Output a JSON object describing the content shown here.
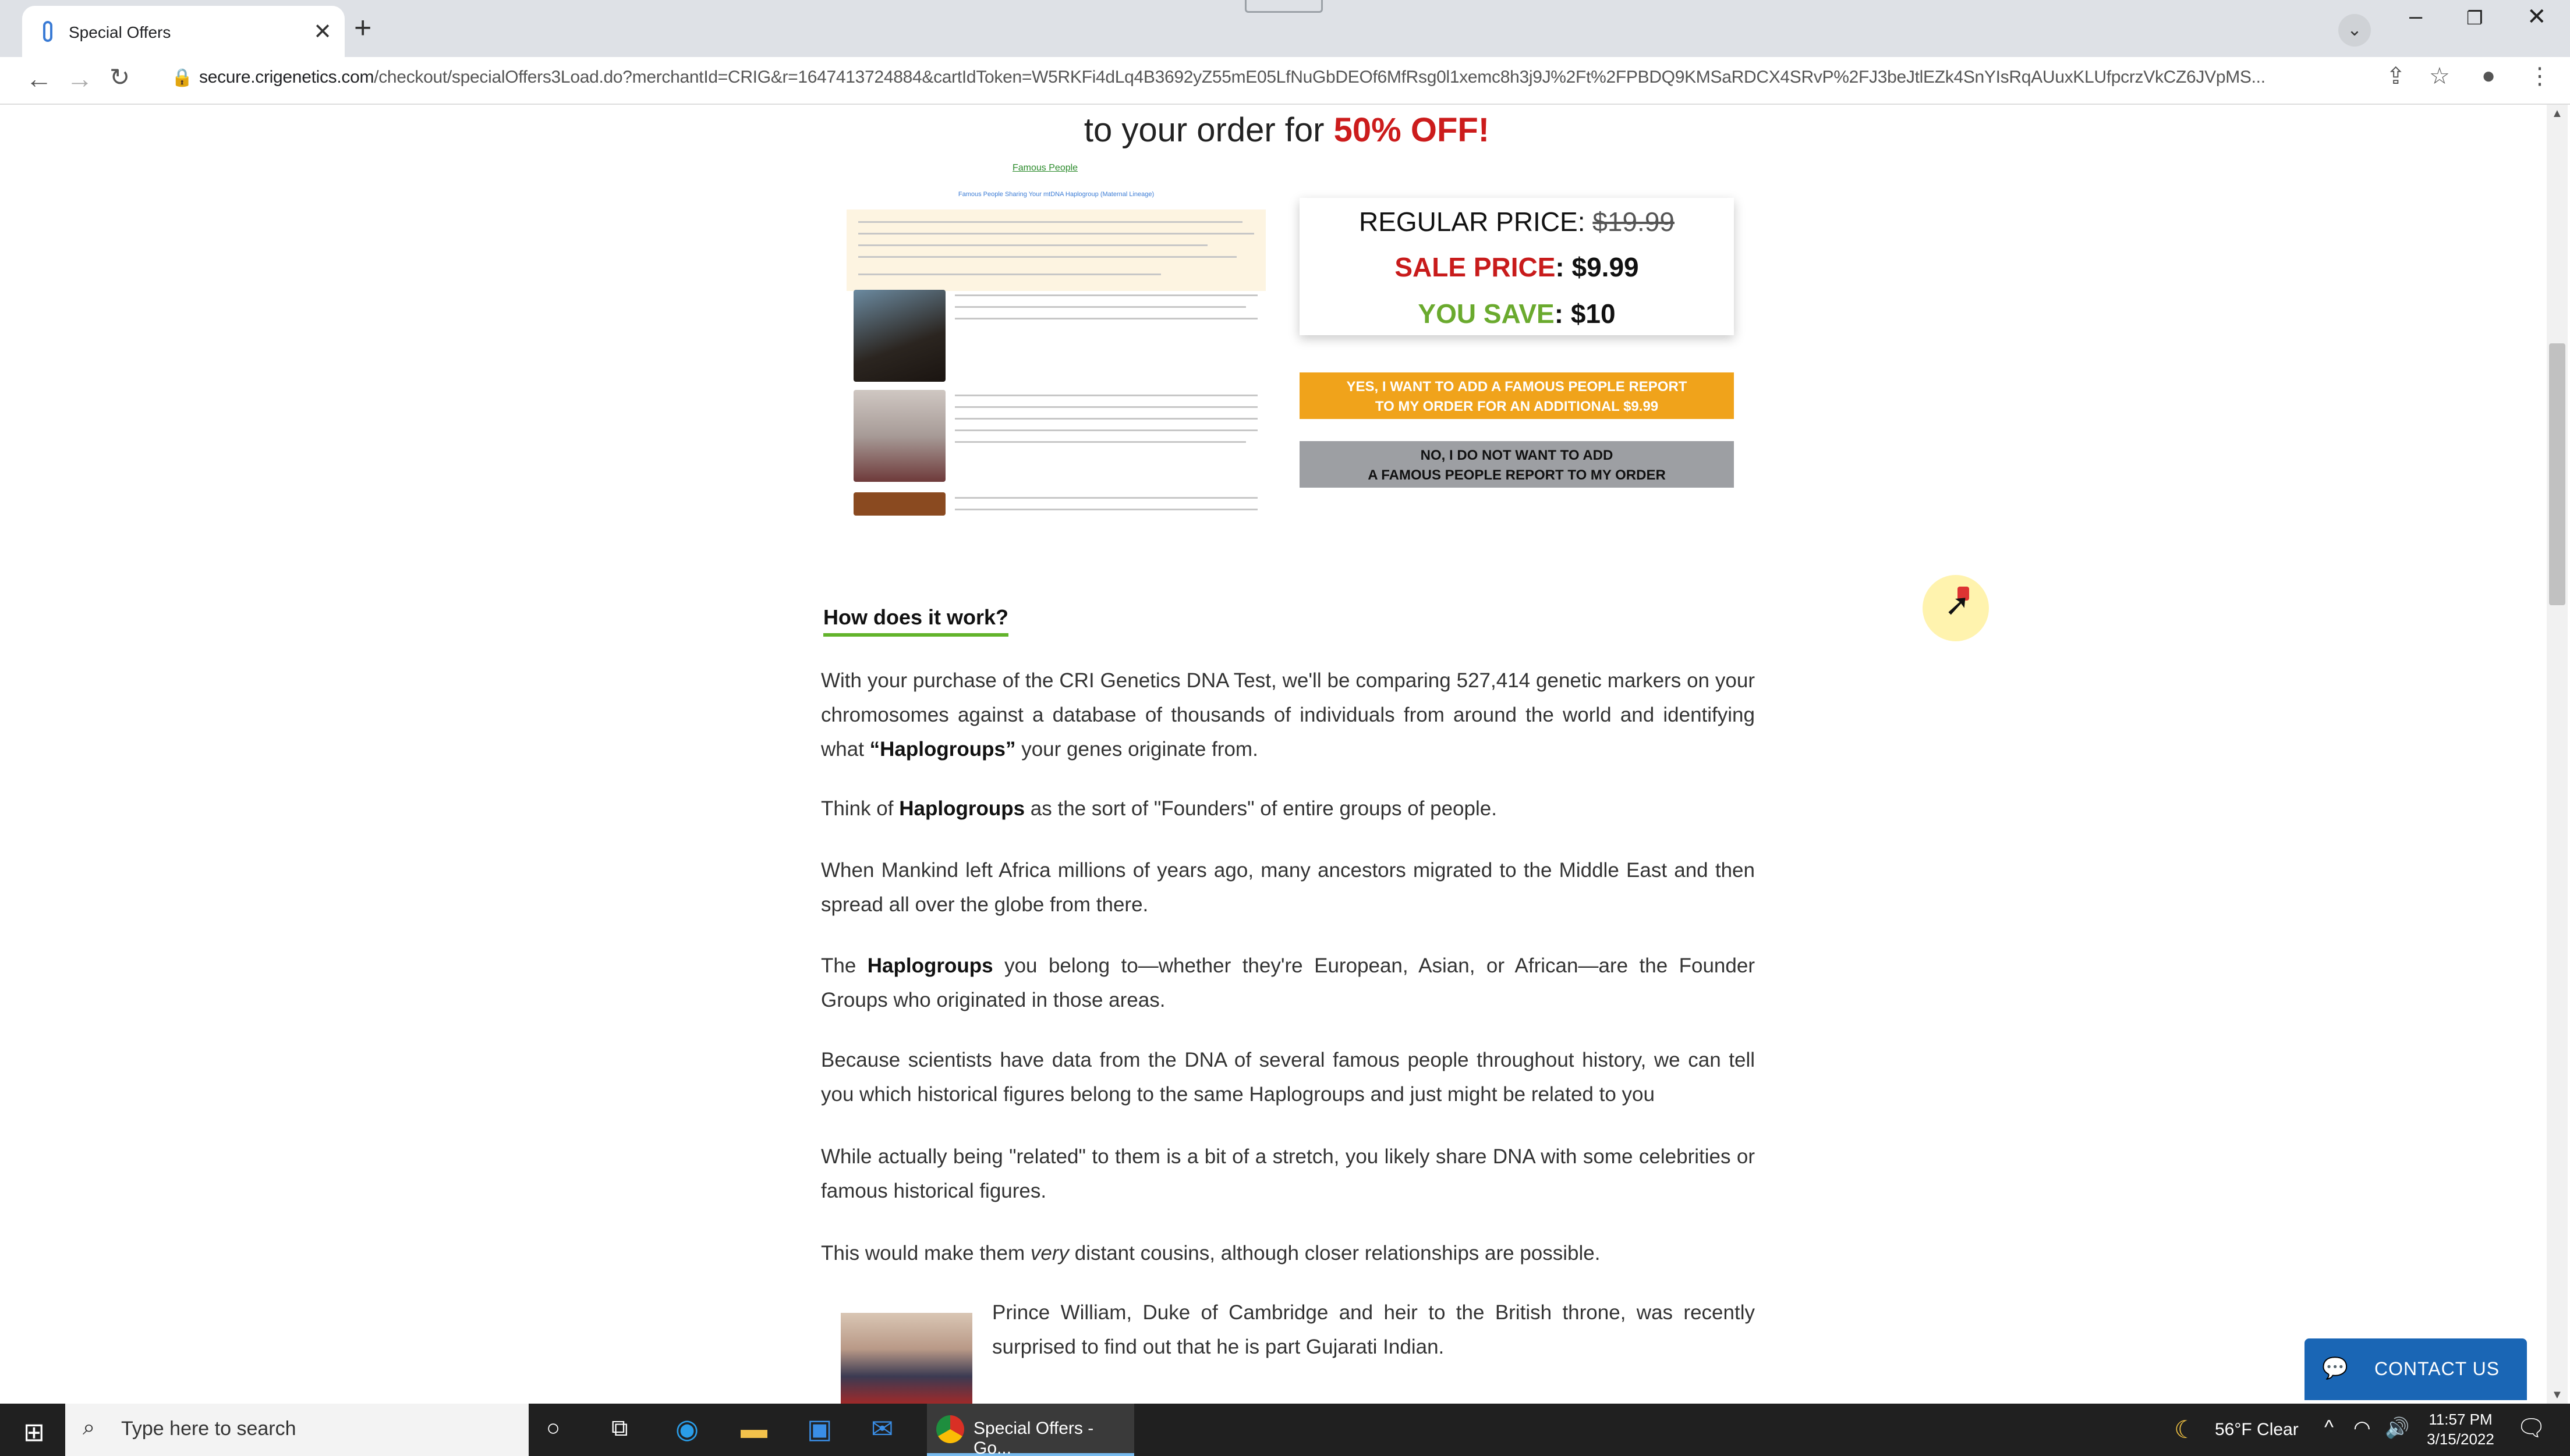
{
  "browser": {
    "tab_title": "Special Offers",
    "url_host": "secure.crigenetics.com",
    "url_path": "/checkout/specialOffers3Load.do?merchantId=CRIG&r=1647413724884&cartIdToken=W5RKFi4dLq4B3692yZ55mE05LfNuGbDEOf6MfRsg0l1xemc8h3j9J%2Ft%2FPBDQ9KMSaRDCX4SRvP%2FJ3beJtlEZk4SnYIsRqAUuxKLUfpcrzVkCZ6JVpMS..."
  },
  "offer": {
    "headline_prefix": "to your order for",
    "headline_highlight": "50% OFF!",
    "preview": {
      "title": "Famous People",
      "subtitle": "Famous People Sharing Your mtDNA Haplogroup (Maternal Lineage)"
    },
    "regular_price_label": "REGULAR PRICE:",
    "regular_price_value": "$19.99",
    "sale_price_label": "SALE PRICE",
    "sale_price_value": ": $9.99",
    "you_save_label": "YOU SAVE",
    "you_save_value": ": $10",
    "yes_button_line1": "YES, I WANT TO ADD A FAMOUS PEOPLE REPORT",
    "yes_button_line2": "TO MY ORDER FOR AN ADDITIONAL $9.99",
    "no_button_line1": "NO, I DO NOT WANT TO ADD",
    "no_button_line2": "A FAMOUS PEOPLE REPORT TO MY ORDER"
  },
  "article": {
    "heading": "How does it work?",
    "p1_a": "With your purchase of the CRI Genetics DNA Test, we'll be comparing 527,414 genetic markers on your chromosomes against a database of thousands of individuals from around the world and identifying what ",
    "p1_b": "“Haplogroups”",
    "p1_c": " your genes originate from.",
    "p2_a": "Think of ",
    "p2_b": "Haplogroups",
    "p2_c": " as the sort of \"Founders\" of entire groups of people.",
    "p3": "When Mankind left Africa millions of years ago, many ancestors migrated to the Middle East and then spread all over the globe from there.",
    "p4_a": "The ",
    "p4_b": "Haplogroups",
    "p4_c": " you belong to—whether they're European, Asian, or African—are the Founder Groups who originated in those areas.",
    "p5": "Because scientists have data from the DNA of several famous people throughout history, we can tell you which historical figures belong to the same Haplogroups and just might be related to you",
    "p6": "While actually being \"related\" to them is a bit of a stretch, you likely share DNA with some celebrities or famous historical figures.",
    "p7_a": "This would make them ",
    "p7_b": "very",
    "p7_c": " distant cousins, although closer relationships are possible.",
    "p8": "Prince William, Duke of Cambridge and heir to the British throne, was recently surprised to find out that he is part Gujarati Indian."
  },
  "contact_label": "CONTACT US",
  "taskbar": {
    "search_placeholder": "Type here to search",
    "active_app": "Special Offers - Go...",
    "weather": "56°F  Clear",
    "time": "11:57 PM",
    "date": "3/15/2022"
  },
  "icons": {
    "back": "arrow-left",
    "forward": "arrow-right",
    "reload": "reload",
    "lock": "lock",
    "share": "share",
    "star": "star",
    "profile": "person",
    "menu": "kebab"
  },
  "colors": {
    "sale_red": "#c81b1b",
    "save_green": "#6aaa2e",
    "yes_orange": "#f0a31b",
    "no_gray": "#9d9fa3",
    "contact_blue": "#1a66b5",
    "heading_underline": "#62b32b"
  }
}
